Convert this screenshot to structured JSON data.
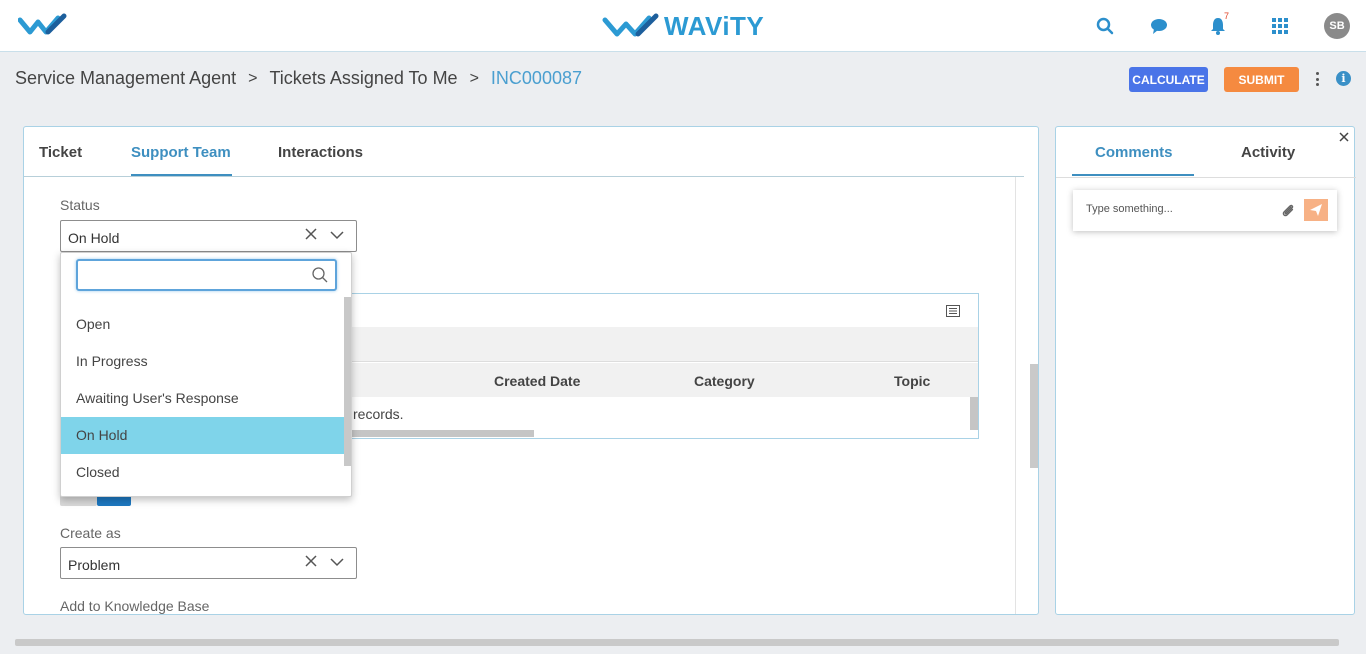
{
  "brand": {
    "name": "WAViTY"
  },
  "header": {
    "notification_count": "7",
    "avatar_initials": "SB"
  },
  "breadcrumb": {
    "items": [
      "Service Management Agent",
      "Tickets Assigned To Me"
    ],
    "separator": ">",
    "current": "INC000087"
  },
  "actions": {
    "calculate_label": "CALCULATE",
    "submit_label": "SUBMIT"
  },
  "main": {
    "tabs": [
      {
        "label": "Ticket"
      },
      {
        "label": "Support Team"
      },
      {
        "label": "Interactions"
      }
    ],
    "active_tab": "Support Team",
    "status": {
      "label": "Status",
      "value": "On Hold",
      "options": [
        {
          "label": "Open"
        },
        {
          "label": "In Progress"
        },
        {
          "label": "Awaiting User's Response"
        },
        {
          "label": "On Hold"
        },
        {
          "label": "Closed"
        }
      ],
      "search_value": ""
    },
    "grid": {
      "columns": [
        "Created Date",
        "Category",
        "Topic"
      ],
      "empty_text_fragment": "records."
    },
    "create_as": {
      "label": "Create as",
      "value": "Problem"
    },
    "kb_label": "Add to Knowledge Base"
  },
  "side": {
    "tabs": [
      {
        "label": "Comments"
      },
      {
        "label": "Activity"
      }
    ],
    "active_tab": "Comments",
    "comment_placeholder": "Type something..."
  },
  "colors": {
    "accent": "#3e8fc0",
    "calculate": "#4a74e8",
    "submit": "#f58a40",
    "selected_option": "#7fd4ea"
  }
}
